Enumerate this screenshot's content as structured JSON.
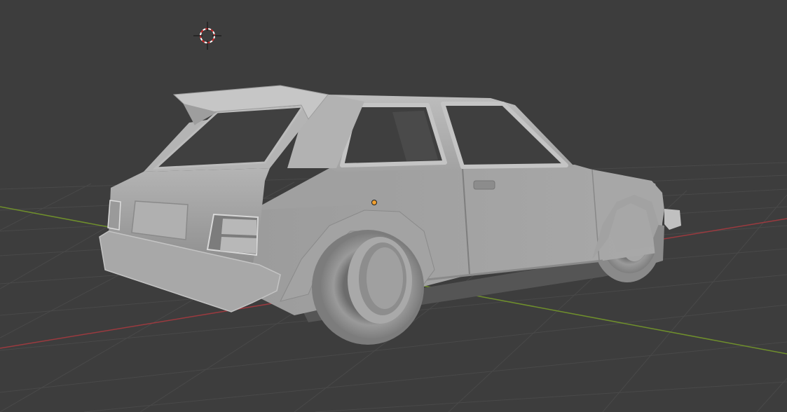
{
  "viewport": {
    "mode": "3d-viewport",
    "shading": "solid",
    "background_color": "#3d3d3d",
    "grid_color": "#4a4a4a",
    "x_axis_color": "#9b3a3f",
    "y_axis_color": "#6f8f2c",
    "model_color": "#a4a4a4"
  },
  "objects": [
    {
      "name": "hatchback-car-model",
      "icon": "mesh-icon"
    }
  ],
  "cursor": {
    "icon": "3d-cursor-icon"
  },
  "origin": {
    "icon": "object-origin-icon",
    "color": "#f0a030"
  }
}
